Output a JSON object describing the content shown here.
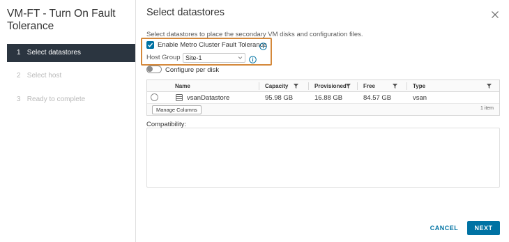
{
  "wizard": {
    "title": "VM-FT - Turn On Fault Tolerance",
    "steps": [
      {
        "num": "1",
        "label": "Select datastores",
        "active": true
      },
      {
        "num": "2",
        "label": "Select host",
        "active": false
      },
      {
        "num": "3",
        "label": "Ready to complete",
        "active": false
      }
    ]
  },
  "page": {
    "title": "Select datastores",
    "intro": "Select datastores to place the secondary VM disks and configuration files."
  },
  "metro": {
    "label": "Enable Metro Cluster Fault Tolerance",
    "checked": true
  },
  "host_group": {
    "label": "Host Group",
    "value": "Site-1"
  },
  "configure_per_disk": {
    "label": "Configure per disk",
    "on": false
  },
  "grid": {
    "columns": [
      "Name",
      "Capacity",
      "Provisioned",
      "Free",
      "Type"
    ],
    "rows": [
      {
        "name": "vsanDatastore",
        "capacity": "95.98 GB",
        "provisioned": "16.88 GB",
        "free": "84.57 GB",
        "type": "vsan"
      }
    ],
    "manage_columns_label": "Manage Columns",
    "item_count": "1 item"
  },
  "compatibility": {
    "label": "Compatibility:"
  },
  "buttons": {
    "cancel": "CANCEL",
    "next": "NEXT"
  },
  "colors": {
    "accent": "#0072a3",
    "highlight": "#d4883a",
    "active_step_bg": "#2b3540"
  },
  "icons": [
    "close-icon",
    "info-icon",
    "chevron-down-icon",
    "filter-icon",
    "datastore-icon",
    "check-icon"
  ]
}
